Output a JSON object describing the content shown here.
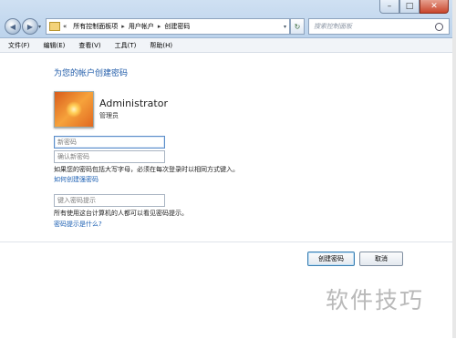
{
  "window": {
    "caption_buttons": {
      "minimize": "–",
      "maximize": "□",
      "close": "✕"
    }
  },
  "nav": {
    "back_glyph": "◀",
    "forward_glyph": "▶",
    "dropdown_glyph": "▾"
  },
  "address": {
    "prefix": "«",
    "crumbs": [
      "所有控制面板项",
      "用户帐户",
      "创建密码"
    ],
    "separator": "▸",
    "dropdown_glyph": "▾",
    "refresh_glyph": "↻"
  },
  "search": {
    "placeholder": "搜索控制面板"
  },
  "menu": {
    "items": [
      "文件(F)",
      "编辑(E)",
      "查看(V)",
      "工具(T)",
      "帮助(H)"
    ]
  },
  "page": {
    "heading": "为您的帐户创建密码",
    "user": {
      "name": "Administrator",
      "role": "管理员"
    },
    "new_password_placeholder": "新密码",
    "confirm_password_placeholder": "确认新密码",
    "uppercase_note": "如果您的密码包括大写字母，必须在每次登录时以相同方式键入。",
    "strong_password_link": "如何创建强密码",
    "hint_placeholder": "键入密码提示",
    "hint_note": "所有使用这台计算机的人都可以看见密码提示。",
    "what_is_hint_link": "密码提示是什么?"
  },
  "buttons": {
    "create": "创建密码",
    "cancel": "取消"
  },
  "watermark": "软件技巧",
  "colors": {
    "heading": "#1e5aa8",
    "link": "#1b5fb3",
    "accent": "#3c7fb1"
  }
}
